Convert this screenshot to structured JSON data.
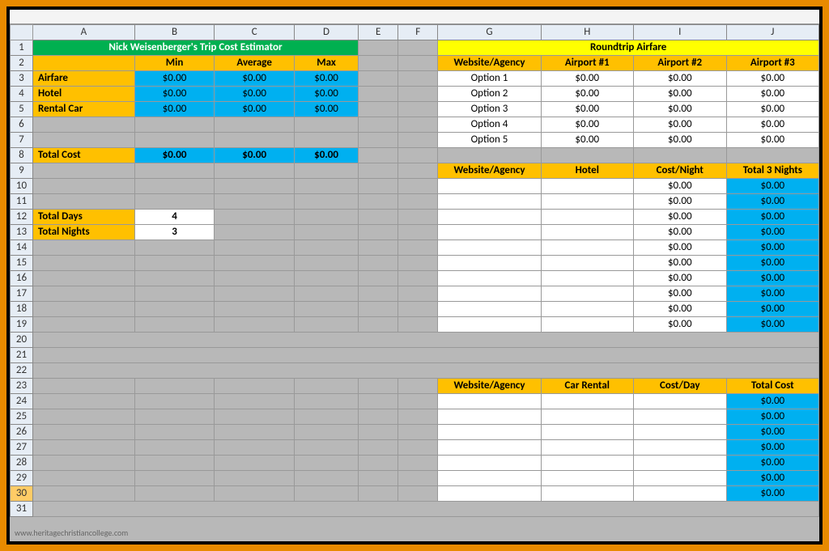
{
  "formula_bar": "",
  "columns": [
    "A",
    "B",
    "C",
    "D",
    "E",
    "F",
    "G",
    "H",
    "I",
    "J"
  ],
  "title_left": "Nick Weisenberger's Trip Cost Estimator",
  "cost_headers": {
    "min": "Min",
    "avg": "Average",
    "max": "Max"
  },
  "cost_rows": [
    {
      "label": "Airfare",
      "min": "$0.00",
      "avg": "$0.00",
      "max": "$0.00"
    },
    {
      "label": "Hotel",
      "min": "$0.00",
      "avg": "$0.00",
      "max": "$0.00"
    },
    {
      "label": "Rental Car",
      "min": "$0.00",
      "avg": "$0.00",
      "max": "$0.00"
    }
  ],
  "total_cost": {
    "label": "Total Cost",
    "min": "$0.00",
    "avg": "$0.00",
    "max": "$0.00"
  },
  "total_days": {
    "label": "Total Days",
    "value": "4"
  },
  "total_nights": {
    "label": "Total Nights",
    "value": "3"
  },
  "airfare_title": "Roundtrip Airfare",
  "airfare_headers": {
    "site": "Website/Agency",
    "a1": "Airport #1",
    "a2": "Airport #2",
    "a3": "Airport #3"
  },
  "airfare_rows": [
    {
      "label": "Option 1",
      "a1": "$0.00",
      "a2": "$0.00",
      "a3": "$0.00"
    },
    {
      "label": "Option 2",
      "a1": "$0.00",
      "a2": "$0.00",
      "a3": "$0.00"
    },
    {
      "label": "Option 3",
      "a1": "$0.00",
      "a2": "$0.00",
      "a3": "$0.00"
    },
    {
      "label": "Option 4",
      "a1": "$0.00",
      "a2": "$0.00",
      "a3": "$0.00"
    },
    {
      "label": "Option 5",
      "a1": "$0.00",
      "a2": "$0.00",
      "a3": "$0.00"
    }
  ],
  "hotel_headers": {
    "site": "Website/Agency",
    "hotel": "Hotel",
    "cost": "Cost/Night",
    "total": "Total 3 Nights"
  },
  "hotel_rows": [
    {
      "site": "",
      "hotel": "",
      "cost": "$0.00",
      "total": "$0.00"
    },
    {
      "site": "",
      "hotel": "",
      "cost": "$0.00",
      "total": "$0.00"
    },
    {
      "site": "",
      "hotel": "",
      "cost": "$0.00",
      "total": "$0.00"
    },
    {
      "site": "",
      "hotel": "",
      "cost": "$0.00",
      "total": "$0.00"
    },
    {
      "site": "",
      "hotel": "",
      "cost": "$0.00",
      "total": "$0.00"
    },
    {
      "site": "",
      "hotel": "",
      "cost": "$0.00",
      "total": "$0.00"
    },
    {
      "site": "",
      "hotel": "",
      "cost": "$0.00",
      "total": "$0.00"
    },
    {
      "site": "",
      "hotel": "",
      "cost": "$0.00",
      "total": "$0.00"
    },
    {
      "site": "",
      "hotel": "",
      "cost": "$0.00",
      "total": "$0.00"
    },
    {
      "site": "",
      "hotel": "",
      "cost": "$0.00",
      "total": "$0.00"
    }
  ],
  "car_headers": {
    "site": "Website/Agency",
    "rental": "Car Rental",
    "cost": "Cost/Day",
    "total": "Total Cost"
  },
  "car_rows": [
    {
      "site": "",
      "rental": "",
      "cost": "",
      "total": "$0.00"
    },
    {
      "site": "",
      "rental": "",
      "cost": "",
      "total": "$0.00"
    },
    {
      "site": "",
      "rental": "",
      "cost": "",
      "total": "$0.00"
    },
    {
      "site": "",
      "rental": "",
      "cost": "",
      "total": "$0.00"
    },
    {
      "site": "",
      "rental": "",
      "cost": "",
      "total": "$0.00"
    },
    {
      "site": "",
      "rental": "",
      "cost": "",
      "total": "$0.00"
    },
    {
      "site": "",
      "rental": "",
      "cost": "",
      "total": "$0.00"
    }
  ],
  "watermark": "www.heritagechristiancollege.com",
  "selected_row": 30
}
